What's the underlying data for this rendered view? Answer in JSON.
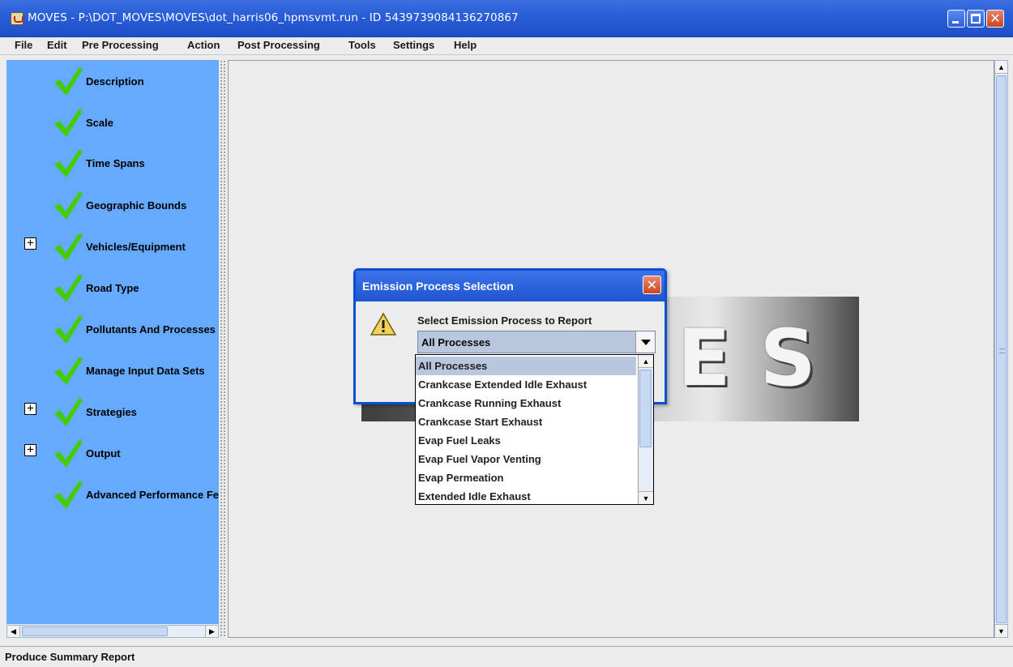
{
  "window": {
    "title": "MOVES - P:\\DOT_MOVES\\MOVES\\dot_harris06_hpmsvmt.run - ID 5439739084136270867",
    "close_glyph": "✕"
  },
  "menu": [
    {
      "label": "File"
    },
    {
      "label": "Edit"
    },
    {
      "label": "Pre Processing"
    },
    {
      "label": "Action"
    },
    {
      "label": "Post Processing"
    },
    {
      "label": "Tools"
    },
    {
      "label": "Settings"
    },
    {
      "label": "Help"
    }
  ],
  "sidebar": {
    "items": [
      {
        "label": "Description",
        "expandable": false
      },
      {
        "label": "Scale",
        "expandable": false
      },
      {
        "label": "Time Spans",
        "expandable": false
      },
      {
        "label": "Geographic Bounds",
        "expandable": false
      },
      {
        "label": "Vehicles/Equipment",
        "expandable": true
      },
      {
        "label": "Road Type",
        "expandable": false
      },
      {
        "label": "Pollutants And Processes",
        "expandable": false
      },
      {
        "label": "Manage Input Data Sets",
        "expandable": false
      },
      {
        "label": "Strategies",
        "expandable": true
      },
      {
        "label": "Output",
        "expandable": true
      },
      {
        "label": "Advanced Performance Features",
        "expandable": false
      }
    ],
    "expand_glyph": "+",
    "check_color": "#44cc00",
    "background": "#66aaff"
  },
  "logo": {
    "text": "ES"
  },
  "dialog": {
    "title": "Emission Process Selection",
    "close_glyph": "✕",
    "prompt": "Select Emission Process to Report",
    "selected": "All Processes",
    "options": [
      "All Processes",
      "Crankcase Extended Idle Exhaust",
      "Crankcase Running Exhaust",
      "Crankcase Start Exhaust",
      "Evap Fuel Leaks",
      "Evap Fuel Vapor Venting",
      "Evap Permeation",
      "Extended Idle Exhaust"
    ]
  },
  "status": {
    "text": "Produce Summary Report"
  }
}
